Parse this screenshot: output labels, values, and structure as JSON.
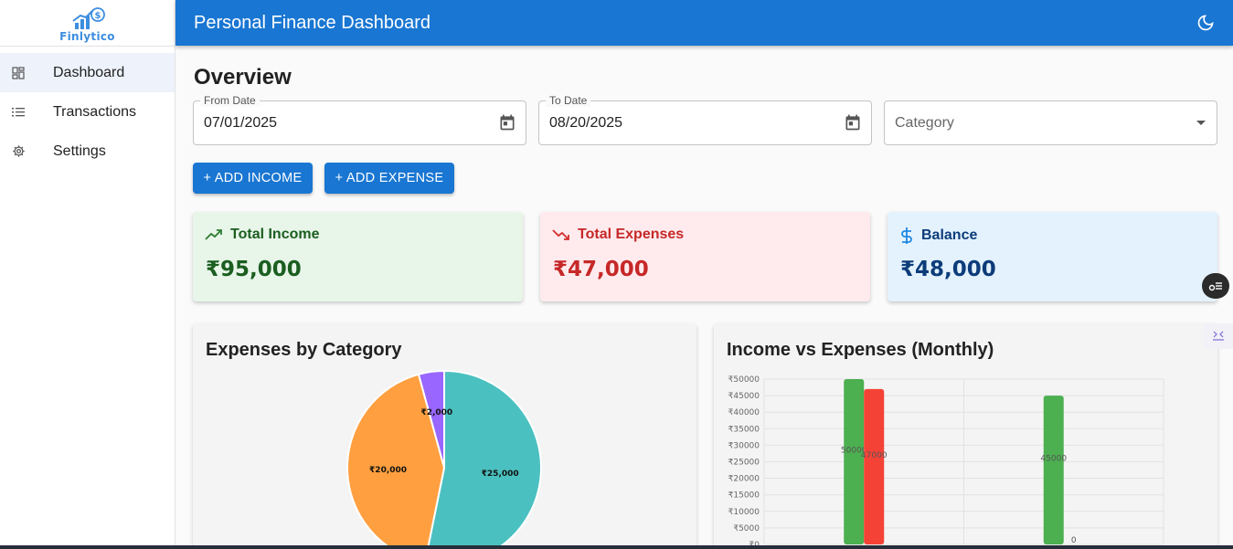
{
  "app": {
    "logo_text": "Finlytico",
    "header_title": "Personal Finance Dashboard"
  },
  "sidebar": {
    "items": [
      {
        "label": "Dashboard",
        "icon": "dashboard-icon",
        "active": true
      },
      {
        "label": "Transactions",
        "icon": "list-icon",
        "active": false
      },
      {
        "label": "Settings",
        "icon": "gear-icon",
        "active": false
      }
    ]
  },
  "overview": {
    "title": "Overview",
    "from_date": {
      "label": "From Date",
      "value": "07/01/2025"
    },
    "to_date": {
      "label": "To Date",
      "value": "08/20/2025"
    },
    "category": {
      "placeholder": "Category"
    },
    "add_income_label": "+ ADD INCOME",
    "add_expense_label": "+ ADD EXPENSE"
  },
  "summary": {
    "income": {
      "title": "Total Income",
      "value": "₹95,000",
      "color": "#1b5e20",
      "bg": "#e8f5e9",
      "icon": "trending-up-icon"
    },
    "expenses": {
      "title": "Total Expenses",
      "value": "₹47,000",
      "color": "#c62828",
      "bg": "#ffebee",
      "icon": "trending-down-icon"
    },
    "balance": {
      "title": "Balance",
      "value": "₹48,000",
      "color": "#0d3c7a",
      "bg": "#e3f2fd",
      "icon": "dollar-icon"
    }
  },
  "colors": {
    "primary": "#1976d2"
  },
  "charts": {
    "pie_title": "Expenses by Category",
    "bar_title": "Income vs Expenses (Monthly)"
  },
  "chart_data": [
    {
      "type": "pie",
      "title": "Expenses by Category",
      "values": [
        25000,
        20000,
        2000
      ],
      "labels": [
        "₹25,000",
        "₹20,000",
        "₹2,000"
      ],
      "colors": [
        "#4bc0c0",
        "#ff9f40",
        "#9966ff"
      ]
    },
    {
      "type": "bar",
      "title": "Income vs Expenses (Monthly)",
      "categories": [
        "",
        ""
      ],
      "series": [
        {
          "values": [
            50000,
            45000
          ],
          "labels": [
            "50000",
            "45000"
          ],
          "color": "#4caf50"
        },
        {
          "values": [
            47000,
            0
          ],
          "labels": [
            "47000",
            "0"
          ],
          "color": "#f44336"
        }
      ],
      "ylim": [
        0,
        50000
      ],
      "yticks": [
        "₹0",
        "₹5000",
        "₹10000",
        "₹15000",
        "₹20000",
        "₹25000",
        "₹30000",
        "₹35000",
        "₹40000",
        "₹45000",
        "₹50000"
      ],
      "grid": true
    }
  ]
}
